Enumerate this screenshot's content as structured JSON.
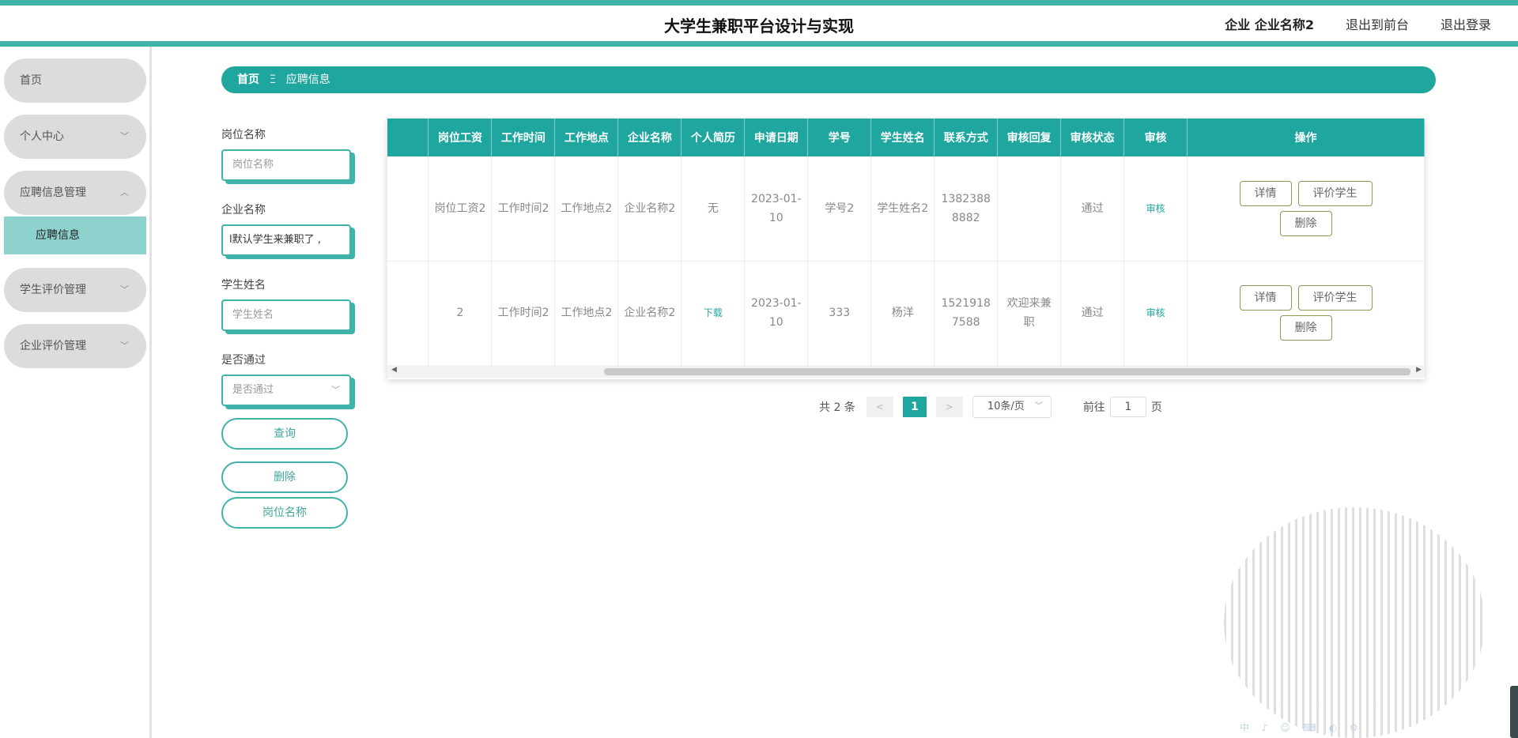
{
  "header": {
    "title": "大学生兼职平台设计与实现",
    "user_label": "企业 企业名称2",
    "back_to_front": "退出到前台",
    "logout": "退出登录"
  },
  "sidebar": {
    "items": [
      {
        "label": "首页",
        "chevron": ""
      },
      {
        "label": "个人中心",
        "chevron": "﹀"
      },
      {
        "label": "应聘信息管理",
        "chevron": "︿"
      },
      {
        "label": "学生评价管理",
        "chevron": "﹀"
      },
      {
        "label": "企业评价管理",
        "chevron": "﹀"
      }
    ],
    "submenu": {
      "label": "应聘信息"
    }
  },
  "breadcrumb": {
    "home": "首页",
    "sep": "Ξ",
    "current": "应聘信息"
  },
  "filters": {
    "position_label": "岗位名称",
    "position_placeholder": "岗位名称",
    "company_label": "企业名称",
    "company_value": "l默认学生来兼职了 ,",
    "student_label": "学生姓名",
    "student_placeholder": "学生姓名",
    "pass_label": "是否通过",
    "pass_placeholder": "是否通过",
    "query_btn": "查询",
    "delete_btn": "删除",
    "position_btn": "岗位名称"
  },
  "table": {
    "columns": [
      "",
      "岗位工资",
      "工作时间",
      "工作地点",
      "企业名称",
      "个人简历",
      "申请日期",
      "学号",
      "学生姓名",
      "联系方式",
      "审核回复",
      "审核状态",
      "审核",
      "操作"
    ],
    "rows": [
      {
        "salary": "岗位工资2",
        "time": "工作时间2",
        "place": "工作地点2",
        "company": "企业名称2",
        "resume": "无",
        "date": "2023-01-10",
        "sid": "学号2",
        "sname": "学生姓名2",
        "phone": "13823888882",
        "reply": "",
        "status": "通过",
        "audit": "审核"
      },
      {
        "salary": "2",
        "time": "工作时间2",
        "place": "工作地点2",
        "company": "企业名称2",
        "resume": "下载",
        "date": "2023-01-10",
        "sid": "333",
        "sname": "杨洋",
        "phone": "15219187588",
        "reply": "欢迎来兼职",
        "status": "通过",
        "audit": "审核"
      }
    ],
    "ops": {
      "detail": "详情",
      "rate": "评价学生",
      "delete": "删除"
    }
  },
  "pagination": {
    "total": "共 2 条",
    "prev": "<",
    "current": "1",
    "next": ">",
    "page_size": "10条/页",
    "goto_label": "前往",
    "goto_value": "1",
    "page_suffix": "页"
  },
  "ime": "中 ♪ ☺ ⌨ ◐ ⚙",
  "colors": {
    "accent": "#1fa79f",
    "accent_light": "#3fb2aa",
    "submenu": "#8ed2ce"
  }
}
